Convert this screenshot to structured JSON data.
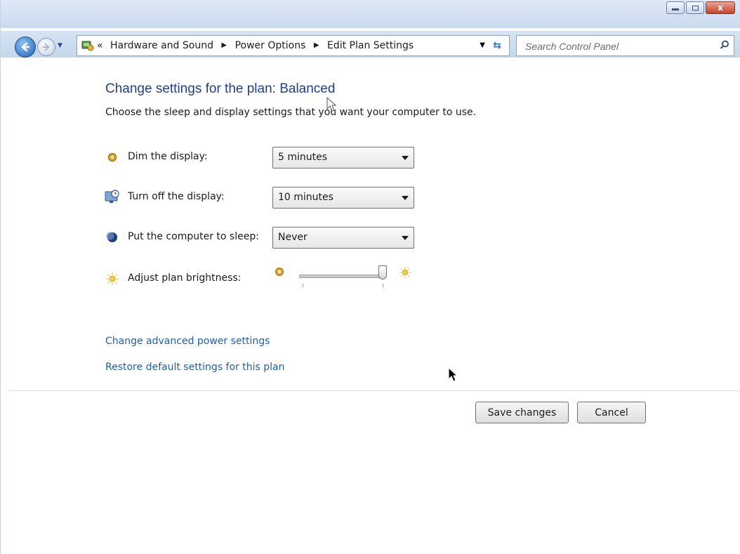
{
  "window": {
    "controls": {
      "minimize_icon": "minimize-icon",
      "maximize_icon": "maximize-icon",
      "close_icon": "close-icon",
      "close_glyph": "x"
    }
  },
  "navigation": {
    "breadcrumbs": [
      "Hardware and Sound",
      "Power Options",
      "Edit Plan Settings"
    ],
    "overflow_glyph": "«",
    "separator_glyph": "▶",
    "search_placeholder": "Search Control Panel"
  },
  "page": {
    "title": "Change settings for the plan: Balanced",
    "subtitle": "Choose the sleep and display settings that you want your computer to use."
  },
  "settings": {
    "dim_display": {
      "label": "Dim the display:",
      "value": "5 minutes",
      "icon": "dim-display-icon"
    },
    "turn_off_display": {
      "label": "Turn off the display:",
      "value": "10 minutes",
      "icon": "monitor-clock-icon"
    },
    "sleep": {
      "label": "Put the computer to sleep:",
      "value": "Never",
      "icon": "moon-sleep-icon"
    },
    "brightness": {
      "label": "Adjust plan brightness:",
      "value_fraction": 1.0,
      "icon": "brightness-icon"
    }
  },
  "links": {
    "advanced": "Change advanced power settings",
    "restore": "Restore default settings for this plan"
  },
  "buttons": {
    "save": "Save changes",
    "cancel": "Cancel"
  },
  "colors": {
    "title": "#1e3e8f",
    "link": "#1e5eb0",
    "close_button": "#c6422a"
  }
}
